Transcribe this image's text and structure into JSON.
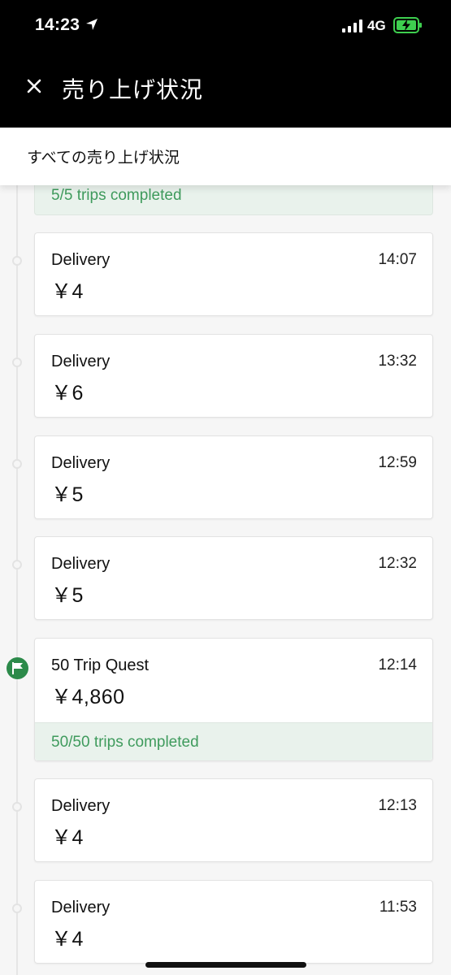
{
  "status_bar": {
    "time": "14:23",
    "network": "4G",
    "icons": [
      "location-arrow-icon",
      "signal-bars-icon",
      "battery-charging-icon"
    ],
    "battery_color": "#3ecf4f"
  },
  "header": {
    "title": "売り上げ状況",
    "close_icon": "close-icon"
  },
  "sub_header": {
    "label": "すべての売り上げ状況"
  },
  "partial_quest": {
    "footer": "5/5 trips completed"
  },
  "cards": [
    {
      "type": "Delivery",
      "time": "14:07",
      "amount": "￥4"
    },
    {
      "type": "Delivery",
      "time": "13:32",
      "amount": "￥6"
    },
    {
      "type": "Delivery",
      "time": "12:59",
      "amount": "￥5"
    },
    {
      "type": "Delivery",
      "time": "12:32",
      "amount": "￥5"
    },
    {
      "type": "50 Trip Quest",
      "time": "12:14",
      "amount": "￥4,860",
      "footer": "50/50 trips completed"
    },
    {
      "type": "Delivery",
      "time": "12:13",
      "amount": "￥4"
    },
    {
      "type": "Delivery",
      "time": "11:53",
      "amount": "￥4"
    }
  ],
  "colors": {
    "header_bg": "#000000",
    "accent_green": "#3f9b5d",
    "quest_bg": "#e9f2ec",
    "flag_green": "#2c8a4a"
  }
}
